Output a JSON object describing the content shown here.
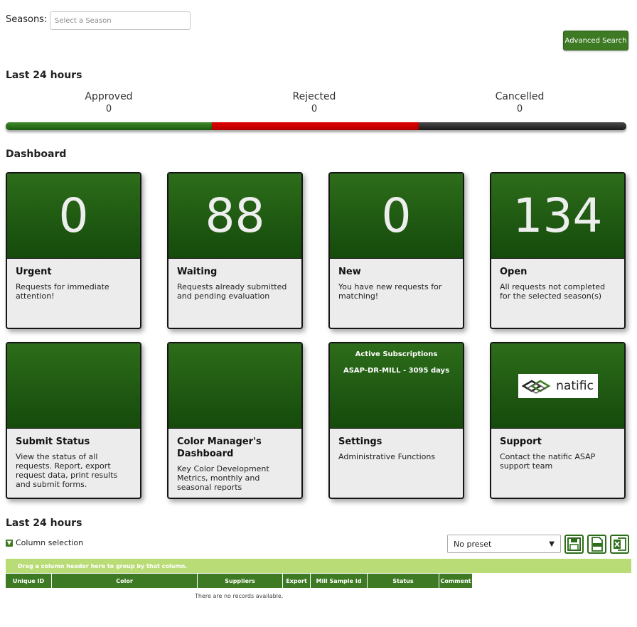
{
  "seasons": {
    "label": "Seasons:",
    "placeholder": "Select a Season"
  },
  "advanced_search_label": "Advanced Search",
  "last24": {
    "title": "Last 24 hours",
    "stats": [
      {
        "label": "Approved",
        "value": "0"
      },
      {
        "label": "Rejected",
        "value": "0"
      },
      {
        "label": "Cancelled",
        "value": "0"
      }
    ]
  },
  "dashboard": {
    "title": "Dashboard",
    "tiles": [
      {
        "number": "88",
        "title": "Waiting",
        "desc": "Requests already submitted and pending evaluation"
      },
      {
        "number": "0",
        "title": "Urgent",
        "desc": "Requests for immediate attention!"
      },
      {
        "number": "0",
        "title": "New",
        "desc": "You have new requests for matching!"
      },
      {
        "number": "134",
        "title": "Open",
        "desc": "All requests not completed for the selected season(s)"
      },
      {
        "title": "Submit Status",
        "desc": "View the status of all requests. Report, export request data, print results and submit forms."
      },
      {
        "title": "Color Manager's Dashboard",
        "desc": "Key Color Development Metrics, monthly and seasonal reports"
      },
      {
        "title": "Settings",
        "desc": "Administrative Functions"
      },
      {
        "title": "Support",
        "desc": "Contact the natific ASAP support team"
      }
    ],
    "subscriptions": {
      "heading": "Active Subscriptions",
      "line": "ASAP-DR-MILL - 3095 days"
    },
    "logo_text": "natific"
  },
  "grid": {
    "title": "Last 24 hours",
    "column_selection": "Column selection",
    "preset": "No preset",
    "group_hint": "Drag a column header here to group by that column.",
    "columns": [
      "Unique ID",
      "Color",
      "Suppliers",
      "Export",
      "Mill Sample Id",
      "Status",
      "Comment"
    ],
    "empty": "There are no records available."
  },
  "colors": {
    "accent": "#3d7a23",
    "tile_green": "#1f5c12",
    "rejected": "#cc0000",
    "cancelled": "#2a2a2a",
    "group_bar": "#b9dc76"
  }
}
